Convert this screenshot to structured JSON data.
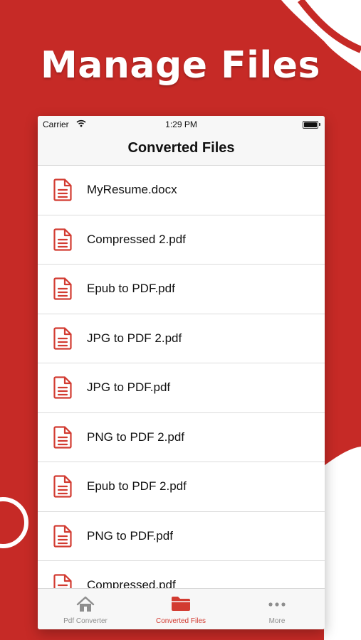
{
  "headline": "Manage Files",
  "colors": {
    "brand_red": "#c62a26",
    "accent": "#d23b31",
    "icon_gray": "#8e8e8e"
  },
  "status_bar": {
    "carrier": "Carrier",
    "time": "1:29 PM"
  },
  "nav": {
    "title": "Converted Files"
  },
  "files": [
    {
      "name": "MyResume.docx",
      "icon": "document-icon"
    },
    {
      "name": "Compressed 2.pdf",
      "icon": "document-icon"
    },
    {
      "name": "Epub to PDF.pdf",
      "icon": "document-icon"
    },
    {
      "name": "JPG to PDF 2.pdf",
      "icon": "document-icon"
    },
    {
      "name": "JPG to PDF.pdf",
      "icon": "document-icon"
    },
    {
      "name": "PNG to PDF 2.pdf",
      "icon": "document-icon"
    },
    {
      "name": "Epub to PDF 2.pdf",
      "icon": "document-icon"
    },
    {
      "name": "PNG to PDF.pdf",
      "icon": "document-icon"
    },
    {
      "name": "Compressed.pdf",
      "icon": "document-icon"
    }
  ],
  "tabs": [
    {
      "label": "Pdf Converter",
      "icon": "home-icon",
      "active": false
    },
    {
      "label": "Converted Files",
      "icon": "folder-icon",
      "active": true
    },
    {
      "label": "More",
      "icon": "more-icon",
      "active": false
    }
  ]
}
